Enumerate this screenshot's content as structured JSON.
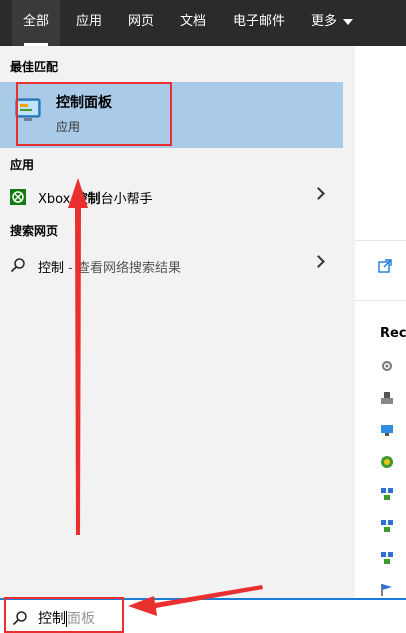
{
  "tabs": [
    {
      "label": "全部",
      "active": true
    },
    {
      "label": "应用"
    },
    {
      "label": "网页"
    },
    {
      "label": "文档"
    },
    {
      "label": "电子邮件"
    },
    {
      "label": "更多"
    }
  ],
  "best_match": {
    "heading": "最佳匹配",
    "title": "控制面板",
    "subtitle": "应用",
    "icon": "control-panel-icon"
  },
  "apps": {
    "heading": "应用",
    "items": [
      {
        "prefix": "Xbox ",
        "highlight": "控制",
        "suffix": "台小帮手",
        "icon": "xbox-icon"
      }
    ]
  },
  "web": {
    "heading": "搜索网页",
    "items": [
      {
        "query": "控制",
        "suffix": " - 查看网络搜索结果",
        "icon": "search-icon"
      }
    ]
  },
  "right_panel": {
    "recent_label": "Rece"
  },
  "search": {
    "typed": "控制",
    "suggestion": "面板",
    "icon": "search-icon"
  },
  "colors": {
    "tab_bar": "#2b2b2b",
    "highlight": "#a9cbe8",
    "annotation": "#ea2f2f",
    "search_border": "#1a7dd8"
  }
}
